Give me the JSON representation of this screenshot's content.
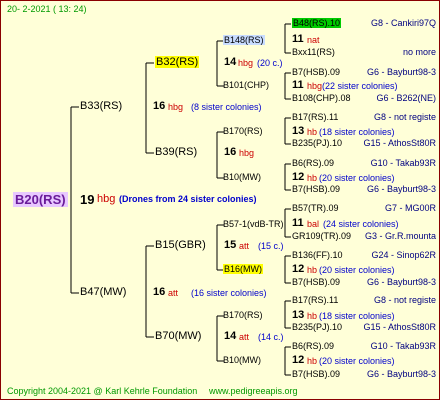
{
  "header": {
    "date": "20-  2-2021 (  13:  24)"
  },
  "footer": {
    "copyright": "Copyright 2004-2021 @ Karl Kehrle Foundation",
    "site": "www.pedigreeapis.org"
  },
  "root": {
    "name": "B20(RS)",
    "num": "19",
    "hbg": "hbg",
    "note": "(Drones from 24 sister colonies)"
  },
  "gen1": [
    {
      "name": "B33(RS)",
      "num": "16",
      "code": "hbg",
      "note": "(8 sister colonies)"
    },
    {
      "name": "B47(MW)",
      "num": "16",
      "code": "att",
      "note": "(16 sister colonies)"
    }
  ],
  "gen2": [
    {
      "name": "B32(RS)",
      "num": "14",
      "code": "hbg",
      "note": "(20 c.)"
    },
    {
      "name": "B39(RS)",
      "num": "16",
      "code": "hbg",
      "note": "(8 sister colonies)"
    },
    {
      "name": "B15(GBR)",
      "num": "15",
      "code": "att",
      "note": "(15 c.)"
    },
    {
      "name": "B70(MW)",
      "num": "14",
      "code": "att",
      "note": "(14 c.)"
    }
  ],
  "gen3": [
    {
      "name": "B148(RS)",
      "num": "11",
      "code": "nat",
      "note": ""
    },
    {
      "name": "B101(CHP)",
      "num": "11",
      "code": "hbg",
      "note": "(22 sister colonies)"
    },
    {
      "name": "B170(RS)",
      "num": "13",
      "code": "hb",
      "note": "(18 sister colonies)"
    },
    {
      "name": "B10(MW)",
      "num": "12",
      "code": "hb",
      "note": "(20 sister colonies)"
    },
    {
      "name": "B57-1(vdB-TR)",
      "num": "11",
      "code": "bal",
      "note": "(24 sister colonies)"
    },
    {
      "name": "B16(MW)",
      "num": "12",
      "code": "hb",
      "note": "(20 sister colonies)"
    },
    {
      "name": "B170(RS)",
      "num": "13",
      "code": "hb",
      "note": "(18 sister colonies)"
    },
    {
      "name": "B10(MW)",
      "num": "12",
      "code": "hb",
      "note": "(20 sister colonies)"
    }
  ],
  "gen4": [
    {
      "name": "B48(RS).10",
      "right": "G8 - Cankiri97Q"
    },
    {
      "name": "Bxx11(RS)",
      "right": "no more"
    },
    {
      "name": "B7(HSB).09",
      "right": "G6 - Bayburt98-3"
    },
    {
      "name": "B108(CHP).08",
      "right": "G6 - B262(NE)"
    },
    {
      "name": "B17(RS).11",
      "right": "G8 - not registe"
    },
    {
      "name": "B235(PJ).10",
      "right": "G15 - AthosSt80R"
    },
    {
      "name": "B6(RS).09",
      "right": "G10 - Takab93R"
    },
    {
      "name": "B7(HSB).09",
      "right": "G6 - Bayburt98-3"
    },
    {
      "name": "B57(TR).09",
      "right": "G7 - MG00R"
    },
    {
      "name": "GR109(TR).09",
      "right": "G3 - Gr.R.mounta"
    },
    {
      "name": "B136(FF).10",
      "right": "G24 - Sinop62R"
    },
    {
      "name": "B7(HSB).09",
      "right": "G6 - Bayburt98-3"
    },
    {
      "name": "B17(RS).11",
      "right": "G8 - not registe"
    },
    {
      "name": "B235(PJ).10",
      "right": "G15 - AthosSt80R"
    },
    {
      "name": "B6(RS).09",
      "right": "G10 - Takab93R"
    },
    {
      "name": "B7(HSB).09",
      "right": "G6 - Bayburt98-3"
    }
  ]
}
